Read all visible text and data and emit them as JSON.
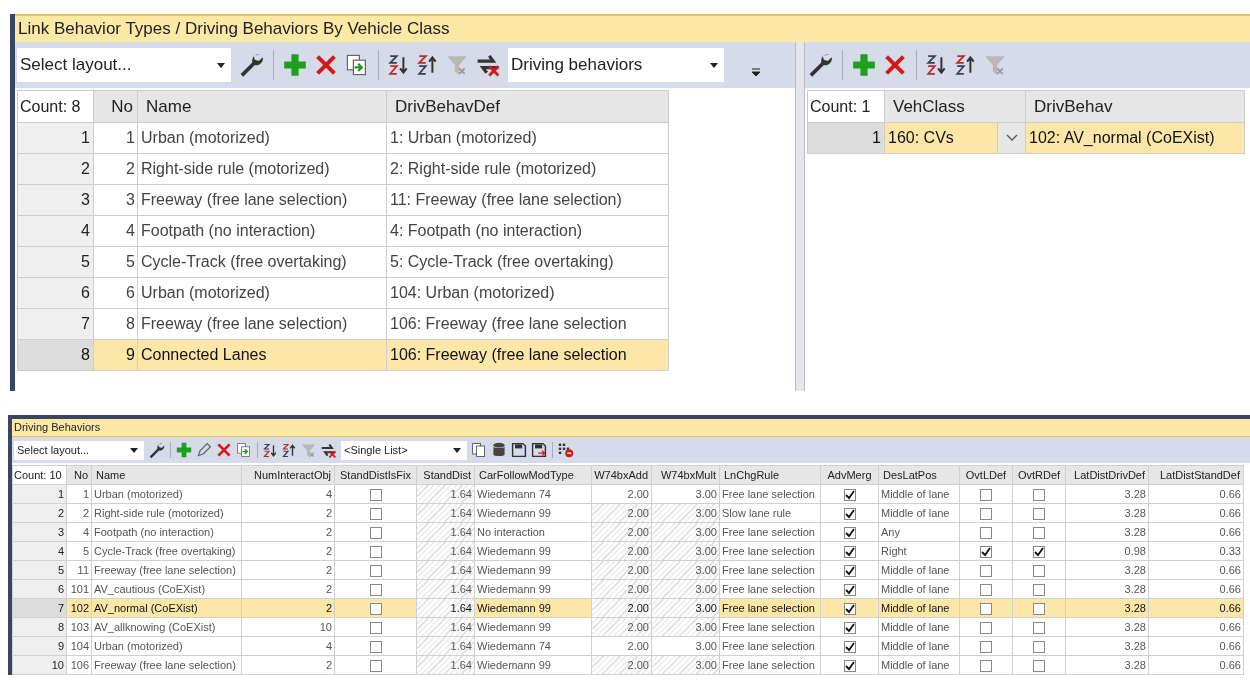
{
  "top_window": {
    "title": "Link Behavior Types / Driving Behaviors By Vehicle Class",
    "toolbar": {
      "layout_select": "Select layout...",
      "list_select": "Driving behaviors"
    },
    "left_table": {
      "count_label": "Count: 8",
      "columns": [
        "No",
        "Name",
        "DrivBehavDef"
      ],
      "rows": [
        {
          "index": "1",
          "selected": false,
          "cells": [
            "1",
            "Urban (motorized)",
            "1: Urban (motorized)"
          ]
        },
        {
          "index": "2",
          "selected": false,
          "cells": [
            "2",
            "Right-side rule (motorized)",
            "2: Right-side rule (motorized)"
          ]
        },
        {
          "index": "3",
          "selected": false,
          "cells": [
            "3",
            "Freeway (free lane selection)",
            "11: Freeway (free lane selection)"
          ]
        },
        {
          "index": "4",
          "selected": false,
          "cells": [
            "4",
            "Footpath (no interaction)",
            "4: Footpath (no interaction)"
          ]
        },
        {
          "index": "5",
          "selected": false,
          "cells": [
            "5",
            "Cycle-Track (free overtaking)",
            "5: Cycle-Track (free overtaking)"
          ]
        },
        {
          "index": "6",
          "selected": false,
          "cells": [
            "6",
            "Urban (motorized)",
            "104: Urban (motorized)"
          ]
        },
        {
          "index": "7",
          "selected": false,
          "cells": [
            "8",
            "Freeway (free lane selection)",
            "106: Freeway (free lane selection"
          ]
        },
        {
          "index": "8",
          "selected": true,
          "cells": [
            "9",
            "Connected Lanes",
            "106: Freeway (free lane selection"
          ]
        }
      ]
    },
    "right_table": {
      "count_label": "Count: 1",
      "columns": [
        "VehClass",
        "DrivBehav"
      ],
      "rows": [
        {
          "index": "1",
          "selected": true,
          "cells": [
            "160: CVs",
            "102: AV_normal (CoEXist)"
          ]
        }
      ]
    }
  },
  "bottom_window": {
    "title": "Driving Behaviors",
    "toolbar": {
      "layout_select": "Select layout...",
      "list_select": "<Single List>"
    },
    "table": {
      "count_label": "Count: 10",
      "columns": [
        {
          "label": "No",
          "kind": "number"
        },
        {
          "label": "Name",
          "kind": "text"
        },
        {
          "label": "NumInteractObj",
          "kind": "number"
        },
        {
          "label": "StandDistIsFix",
          "kind": "check"
        },
        {
          "label": "StandDist",
          "kind": "number"
        },
        {
          "label": "CarFollowModType",
          "kind": "text"
        },
        {
          "label": "W74bxAdd",
          "kind": "number"
        },
        {
          "label": "W74bxMult",
          "kind": "number"
        },
        {
          "label": "LnChgRule",
          "kind": "text"
        },
        {
          "label": "AdvMerg",
          "kind": "check"
        },
        {
          "label": "DesLatPos",
          "kind": "text"
        },
        {
          "label": "OvtLDef",
          "kind": "check"
        },
        {
          "label": "OvtRDef",
          "kind": "check"
        },
        {
          "label": "LatDistDrivDef",
          "kind": "number"
        },
        {
          "label": "LatDistStandDef",
          "kind": "number"
        }
      ],
      "rows": [
        {
          "index": "1",
          "selected": false,
          "stand_dist_disabled": true,
          "w74_disabled": false,
          "cells": [
            "1",
            "Urban (motorized)",
            "4",
            false,
            "1.64",
            "Wiedemann 74",
            "2.00",
            "3.00",
            "Free lane selection",
            true,
            "Middle of lane",
            false,
            false,
            "3.28",
            "0.66"
          ]
        },
        {
          "index": "2",
          "selected": false,
          "stand_dist_disabled": true,
          "w74_disabled": true,
          "cells": [
            "2",
            "Right-side rule (motorized)",
            "2",
            false,
            "1.64",
            "Wiedemann 99",
            "2.00",
            "3.00",
            "Slow lane rule",
            true,
            "Middle of lane",
            false,
            false,
            "3.28",
            "0.66"
          ]
        },
        {
          "index": "3",
          "selected": false,
          "stand_dist_disabled": true,
          "w74_disabled": true,
          "cells": [
            "4",
            "Footpath (no interaction)",
            "2",
            false,
            "1.64",
            "No interaction",
            "2.00",
            "3.00",
            "Free lane selection",
            true,
            "Any",
            false,
            false,
            "3.28",
            "0.66"
          ]
        },
        {
          "index": "4",
          "selected": false,
          "stand_dist_disabled": true,
          "w74_disabled": true,
          "cells": [
            "5",
            "Cycle-Track (free overtaking)",
            "2",
            false,
            "1.64",
            "Wiedemann 99",
            "2.00",
            "3.00",
            "Free lane selection",
            true,
            "Right",
            true,
            true,
            "0.98",
            "0.33"
          ]
        },
        {
          "index": "5",
          "selected": false,
          "stand_dist_disabled": true,
          "w74_disabled": true,
          "cells": [
            "11",
            "Freeway (free lane selection)",
            "2",
            false,
            "1.64",
            "Wiedemann 99",
            "2.00",
            "3.00",
            "Free lane selection",
            true,
            "Middle of lane",
            false,
            false,
            "3.28",
            "0.66"
          ]
        },
        {
          "index": "6",
          "selected": false,
          "stand_dist_disabled": true,
          "w74_disabled": true,
          "cells": [
            "101",
            "AV_cautious (CoEXist)",
            "2",
            false,
            "1.64",
            "Wiedemann 99",
            "2.00",
            "3.00",
            "Free lane selection",
            true,
            "Middle of lane",
            false,
            false,
            "3.28",
            "0.66"
          ]
        },
        {
          "index": "7",
          "selected": true,
          "stand_dist_disabled": true,
          "w74_disabled": true,
          "cells": [
            "102",
            "AV_normal (CoEXist)",
            "2",
            false,
            "1.64",
            "Wiedemann 99",
            "2.00",
            "3.00",
            "Free lane selection",
            true,
            "Middle of lane",
            false,
            false,
            "3.28",
            "0.66"
          ]
        },
        {
          "index": "8",
          "selected": false,
          "stand_dist_disabled": true,
          "w74_disabled": true,
          "cells": [
            "103",
            "AV_allknowing (CoEXist)",
            "10",
            false,
            "1.64",
            "Wiedemann 99",
            "2.00",
            "3.00",
            "Free lane selection",
            true,
            "Middle of lane",
            false,
            false,
            "3.28",
            "0.66"
          ]
        },
        {
          "index": "9",
          "selected": false,
          "stand_dist_disabled": true,
          "w74_disabled": false,
          "cells": [
            "104",
            "Urban (motorized)",
            "4",
            false,
            "1.64",
            "Wiedemann 74",
            "2.00",
            "3.00",
            "Free lane selection",
            true,
            "Middle of lane",
            false,
            false,
            "3.28",
            "0.66"
          ]
        },
        {
          "index": "10",
          "selected": false,
          "stand_dist_disabled": true,
          "w74_disabled": true,
          "cells": [
            "106",
            "Freeway (free lane selection)",
            "2",
            false,
            "1.64",
            "Wiedemann 99",
            "2.00",
            "3.00",
            "Free lane selection",
            true,
            "Middle of lane",
            false,
            false,
            "3.28",
            "0.66"
          ]
        }
      ]
    }
  }
}
